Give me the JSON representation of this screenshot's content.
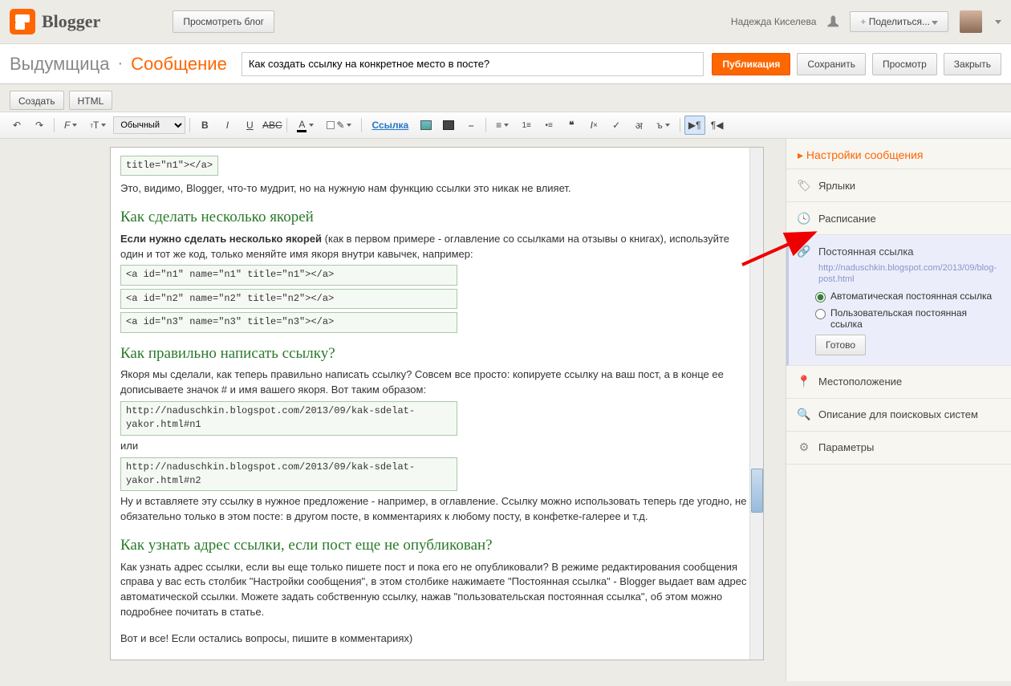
{
  "topbar": {
    "brand": "Blogger",
    "view_blog": "Просмотреть блог",
    "username": "Надежда Киселева",
    "share": "Поделиться..."
  },
  "titlerow": {
    "blog_name": "Выдумщица",
    "separator": "·",
    "page_type": "Сообщение",
    "post_title": "Как создать ссылку на конкретное место в посте?",
    "publish": "Публикация",
    "save": "Сохранить",
    "preview": "Просмотр",
    "close": "Закрыть"
  },
  "tabs": {
    "compose": "Создать",
    "html": "HTML"
  },
  "toolbar": {
    "size_select": "Обычный",
    "link": "Ссылка"
  },
  "content": {
    "line0": "title=\"n1\"></a>",
    "para0": "Это, видимо, Blogger, что-то мудрит, но на нужную нам функцию ссылки это никак не влияет.",
    "h1": "Как сделать несколько якорей",
    "para1_bold": "Если нужно сделать несколько якорей",
    "para1_rest": " (как в первом примере - оглавление со ссылками на отзывы о книгах), используйте один и тот же код, только меняйте имя якоря внутри кавычек, например:",
    "code1": "<a id=\"n1\" name=\"n1\" title=\"n1\"></a>",
    "code2": "<a id=\"n2\" name=\"n2\" title=\"n2\"></a>",
    "code3": "<a id=\"n3\" name=\"n3\" title=\"n3\"></a>",
    "h2": "Как правильно написать ссылку?",
    "para2": "Якоря мы сделали, как теперь правильно написать ссылку? Совсем все просто: копируете ссылку на ваш пост, а в конце ее дописываете значок # и имя вашего якоря. Вот таким образом:",
    "code4": "http://naduschkin.blogspot.com/2013/09/kak-sdelat-yakor.html#n1",
    "or": "или",
    "code5": "http://naduschkin.blogspot.com/2013/09/kak-sdelat-yakor.html#n2",
    "para3": "Ну и вставляете эту ссылку в нужное предложение - например, в оглавление. Ссылку можно использовать теперь где угодно, не обязательно только в этом посте: в другом посте, в комментариях к любому посту, в конфетке-галерее и т.д.",
    "h3": "Как узнать адрес ссылки, если пост еще не опубликован?",
    "para4": "Как узнать адрес ссылки, если вы еще только пишете пост и пока его не опубликовали? В режиме редактирования сообщения справа у вас есть столбик \"Настройки сообщения\", в этом столбике нажимаете \"Постоянная ссылка\" - Blogger выдает вам адрес автоматической ссылки. Можете задать собственную ссылку, нажав \"пользовательская постоянная ссылка\", об этом можно подробнее почитать в статье.",
    "para5": "Вот и все! Если остались вопросы, пишите в комментариях)"
  },
  "sidebar": {
    "header": "Настройки сообщения",
    "labels": "Ярлыки",
    "schedule": "Расписание",
    "permalink": "Постоянная ссылка",
    "permalink_url": "http://naduschkin.blogspot.com/2013/09/blog-post.html",
    "auto": "Автоматическая постоянная ссылка",
    "custom": "Пользовательская постоянная ссылка",
    "done": "Готово",
    "location": "Местоположение",
    "search_desc": "Описание для поисковых систем",
    "options": "Параметры"
  }
}
